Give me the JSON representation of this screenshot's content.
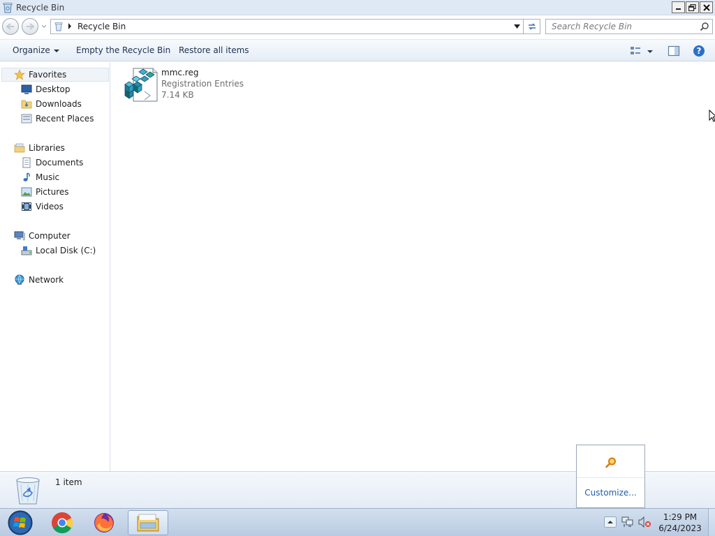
{
  "window": {
    "title": "Recycle Bin"
  },
  "address": {
    "crumb": "Recycle Bin",
    "search_placeholder": "Search Recycle Bin"
  },
  "toolbar": {
    "organize": "Organize",
    "empty_bin": "Empty the Recycle Bin",
    "restore_all": "Restore all items"
  },
  "nav": {
    "favorites": {
      "label": "Favorites",
      "items": [
        "Desktop",
        "Downloads",
        "Recent Places"
      ]
    },
    "libraries": {
      "label": "Libraries",
      "items": [
        "Documents",
        "Music",
        "Pictures",
        "Videos"
      ]
    },
    "computer": {
      "label": "Computer",
      "items": [
        "Local Disk (C:)"
      ]
    },
    "network": {
      "label": "Network"
    }
  },
  "files": [
    {
      "name": "mmc.reg",
      "type": "Registration Entries",
      "size": "7.14 KB",
      "icon": "registry-file-icon"
    }
  ],
  "details": {
    "count": "1 item"
  },
  "popup": {
    "link": "Customize..."
  },
  "taskbar": {
    "apps": [
      "start-orb",
      "chrome-icon",
      "firefox-icon",
      "explorer-icon"
    ],
    "time": "1:29 PM",
    "date": "6/24/2023"
  },
  "colors": {
    "accent": "#1f5ea8",
    "titlebar": "#dfe9f5",
    "taskbar": "#c5d5e9"
  }
}
